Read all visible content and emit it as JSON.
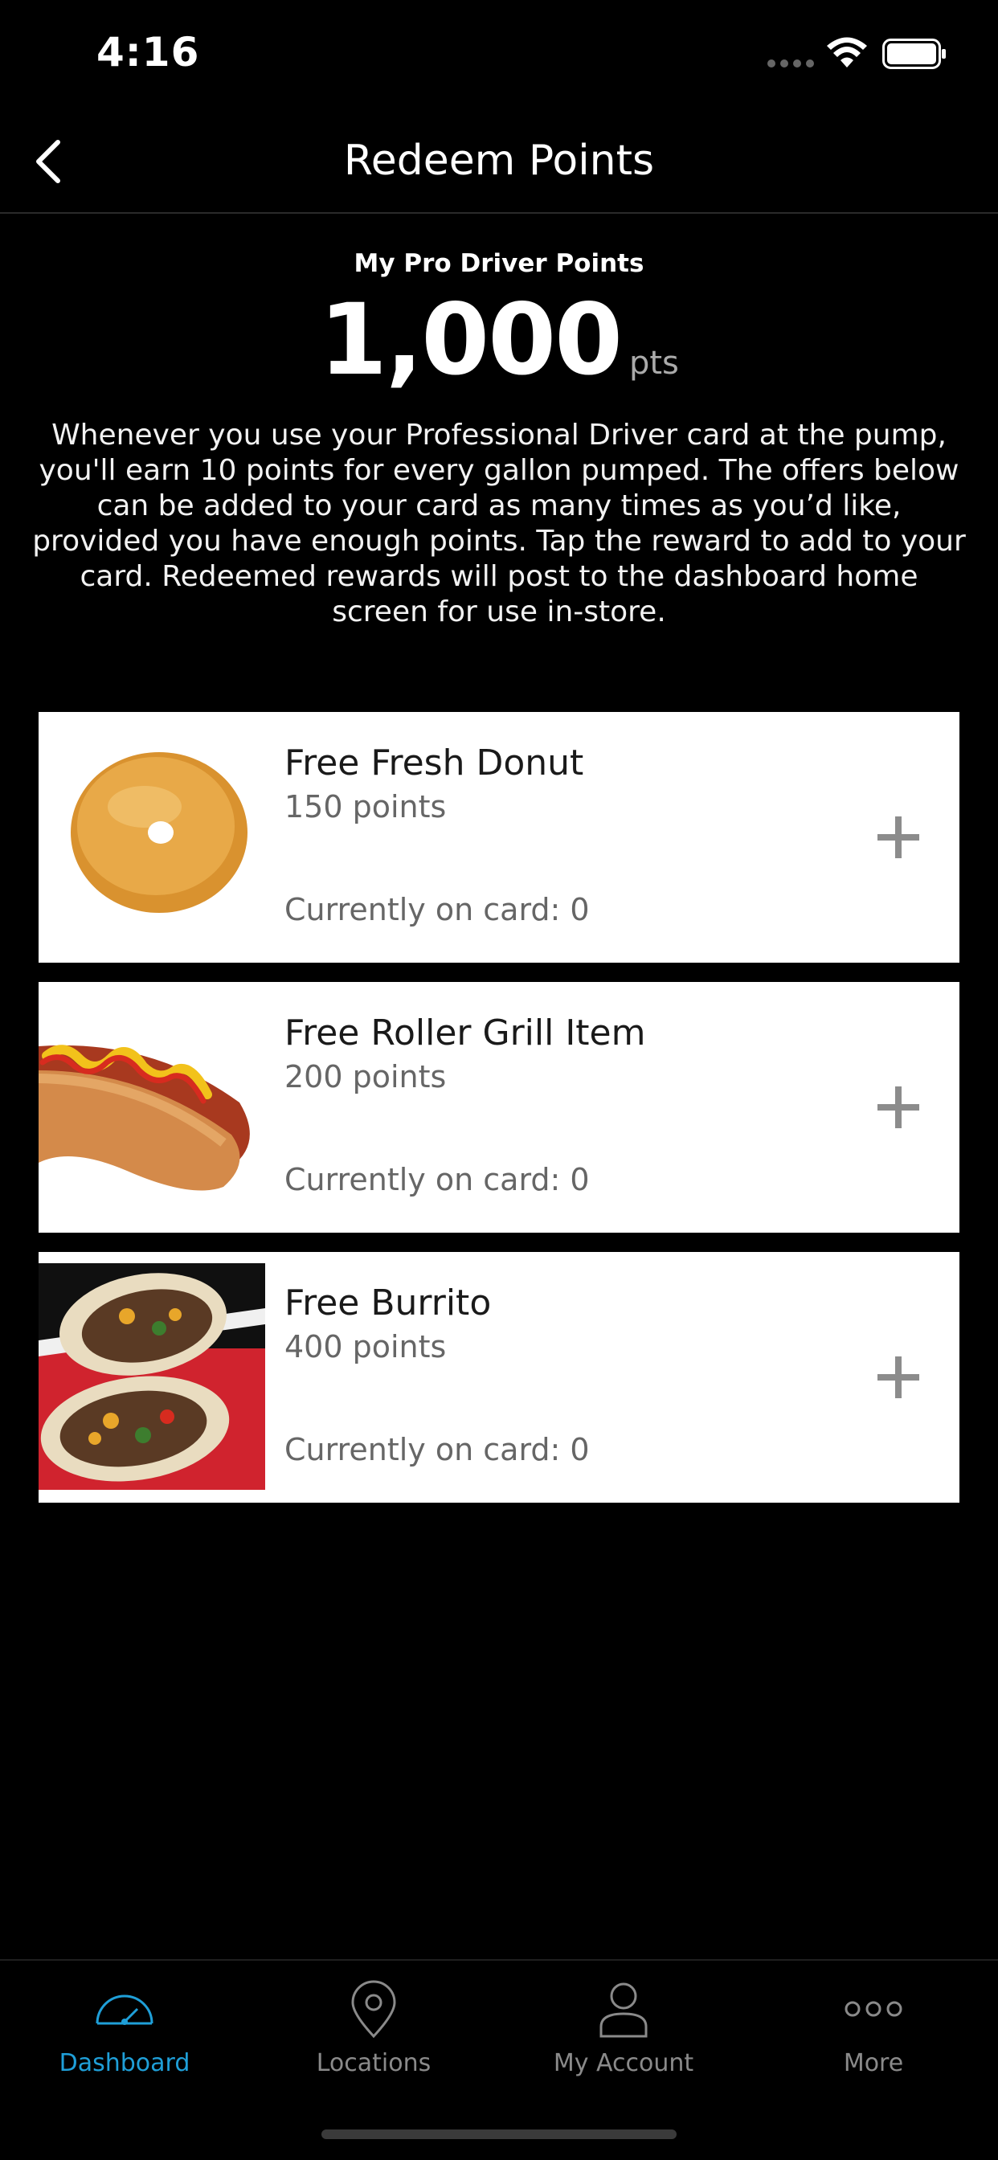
{
  "status_bar": {
    "time": "4:16"
  },
  "header": {
    "title": "Redeem Points",
    "back_icon": "chevron-left-icon"
  },
  "points": {
    "label": "My Pro Driver Points",
    "value": "1,000",
    "unit": "pts",
    "description": "Whenever you use your Professional Driver card at the pump, you'll earn 10 points for every gallon pumped. The offers below can be added to your card as many times as you’d like, provided you have enough points. Tap the reward to add to your card. Redeemed rewards will post to the dashboard home screen for use in-store."
  },
  "rewards": [
    {
      "name": "Free Fresh Donut",
      "points": "150 points",
      "on_card": "Currently on card: 0",
      "image": "donut-image"
    },
    {
      "name": "Free Roller Grill Item",
      "points": "200 points",
      "on_card": "Currently on card: 0",
      "image": "hotdog-image"
    },
    {
      "name": "Free Burrito",
      "points": "400 points",
      "on_card": "Currently on card: 0",
      "image": "burrito-image"
    }
  ],
  "tabs": [
    {
      "label": "Dashboard",
      "icon": "speedometer-icon",
      "active": true
    },
    {
      "label": "Locations",
      "icon": "location-pin-icon",
      "active": false
    },
    {
      "label": "My Account",
      "icon": "person-icon",
      "active": false
    },
    {
      "label": "More",
      "icon": "more-dots-icon",
      "active": false
    }
  ],
  "colors": {
    "background": "#000000",
    "card": "#ffffff",
    "accent": "#1f9fd8",
    "muted": "#8a8a8a"
  }
}
